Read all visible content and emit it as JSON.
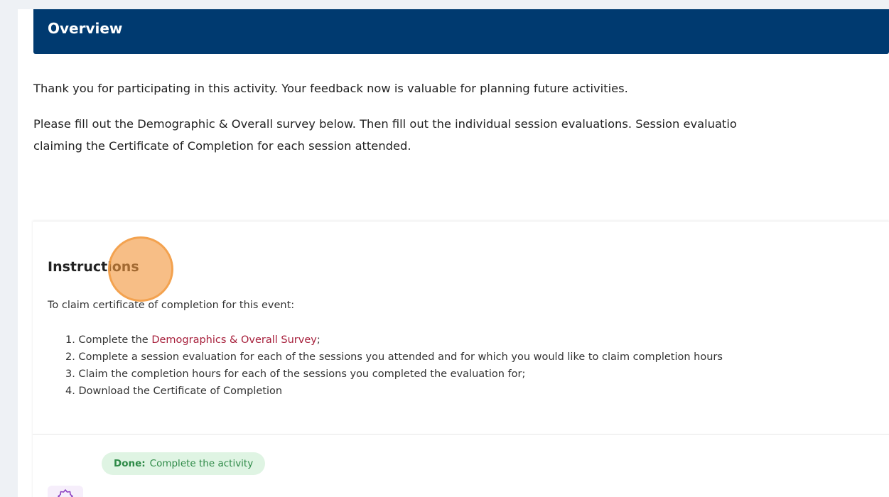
{
  "overview": {
    "title": "Overview",
    "paragraph1": "Thank you for participating in this activity. Your feedback now is valuable for planning future activities.",
    "paragraph2_line1": "Please fill out the Demographic & Overall survey below. Then fill out the individual session evaluations. Session evaluatio",
    "paragraph2_line2": "claiming the Certificate of Completion for each session attended."
  },
  "instructions": {
    "title": "Instructions",
    "lead": "To claim certificate of completion for this event:",
    "steps": [
      {
        "prefix": "1. Complete the ",
        "link": "Demographics & Overall Survey",
        "suffix": ";"
      },
      {
        "text": "2. Complete a session evaluation for each of the sessions you attended and for which you would like to claim completion hours"
      },
      {
        "text": "3. Claim the completion hours for each of the sessions you completed the evaluation for;"
      },
      {
        "text": "4. Download the Certificate of Completion"
      }
    ]
  },
  "status": {
    "done_label": "Done:",
    "text": "Complete the activity"
  },
  "colors": {
    "header_bg": "#003a70",
    "link": "#a61e3a",
    "done_badge_bg": "#dff4e3",
    "done_badge_text": "#2e8a47",
    "click_marker": "#f2963c"
  },
  "icons": {
    "bottom_row_icon": "badge-icon"
  }
}
